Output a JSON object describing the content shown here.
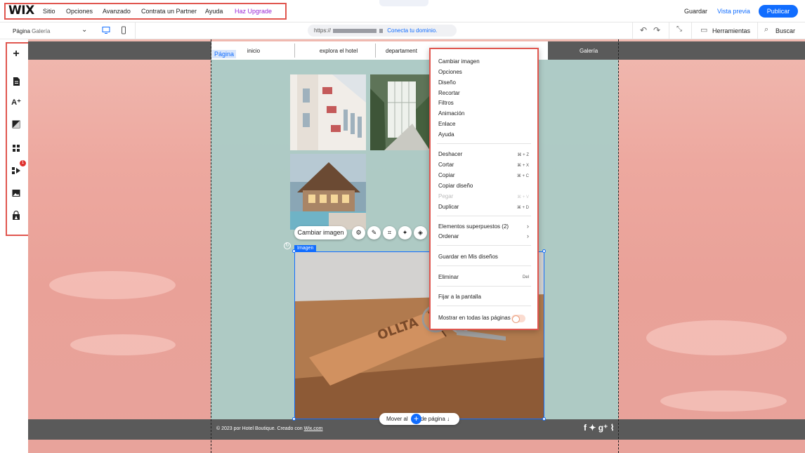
{
  "topbar": {
    "logo": "WIX",
    "menu": [
      "Sitio",
      "Opciones",
      "Avanzado",
      "Contrata un Partner",
      "Ayuda"
    ],
    "upgrade": "Haz Upgrade",
    "save": "Guardar",
    "preview": "Vista previa",
    "publish": "Publicar"
  },
  "bar2": {
    "page_prefix": "Página",
    "page_name": "Galería",
    "url_prefix": "https://",
    "connect_domain": "Conecta tu dominio.",
    "tools": "Herramientas",
    "search": "Buscar"
  },
  "site": {
    "page_tag": "Página",
    "nav": [
      "inicio",
      "explora el hotel",
      "departament"
    ],
    "gallery": "Galería",
    "image_tag": "Imagen",
    "change_image": "Cambiar imagen",
    "move_button": "Mover al",
    "move_button_tail": "de página",
    "copyright": "© 2023 por Hotel Boutique. Creado con ",
    "copyright_link": "Wix.com",
    "social": "f ✦ g⁺ ⌇",
    "selected_image_text": "OLLTA"
  },
  "context_menu": {
    "group1": [
      "Cambiar imagen",
      "Opciones",
      "Diseño",
      "Recortar",
      "Filtros",
      "Animación",
      "Enlace",
      "Ayuda"
    ],
    "group2": [
      {
        "label": "Deshacer",
        "shortcut": "⌘ + Z"
      },
      {
        "label": "Cortar",
        "shortcut": "⌘ + X"
      },
      {
        "label": "Copiar",
        "shortcut": "⌘ + C"
      },
      {
        "label": "Copiar diseño",
        "shortcut": ""
      },
      {
        "label": "Pegar",
        "shortcut": "⌘ + V",
        "disabled": true
      },
      {
        "label": "Duplicar",
        "shortcut": "⌘ + D"
      }
    ],
    "group3": [
      {
        "label": "Elementos superpuestos (2)",
        "shortcut": "›"
      },
      {
        "label": "Ordenar",
        "shortcut": "›"
      }
    ],
    "save_designs": "Guardar en Mis diseños",
    "delete": "Eliminar",
    "delete_shortcut": "Del",
    "pin": "Fijar a la pantalla",
    "show_all": "Mostrar en todas las páginas"
  },
  "lefttools": {
    "badge": "1",
    "items": [
      "add-icon",
      "pages-icon",
      "theme-icon",
      "background-icon",
      "apps-icon",
      "business-apps-icon",
      "media-icon",
      "market-icon"
    ]
  },
  "colors": {
    "accent": "#116dff",
    "highlight": "#e0564f",
    "upgrade": "#9a27d5"
  }
}
